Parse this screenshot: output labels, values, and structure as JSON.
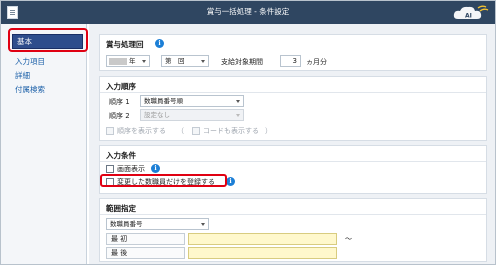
{
  "window": {
    "title": "賞与一括処理 - 条件設定",
    "ai_badge": "AI"
  },
  "sidebar": {
    "items": [
      {
        "label": "基本",
        "active": true
      },
      {
        "label": "入力項目",
        "active": false
      },
      {
        "label": "詳細",
        "active": false
      },
      {
        "label": "付属検索",
        "active": false
      }
    ]
  },
  "sections": {
    "payment_count": {
      "title": "賞与処理回",
      "year_suffix": "年",
      "nth_select": "第",
      "kai_select": "回",
      "period_label": "支給対象期間",
      "period_value": "3",
      "period_unit": "ヵ月分"
    },
    "input_order": {
      "title": "入力順序",
      "order1_label": "順序 1",
      "order1_value": "数職員番号順",
      "order2_label": "順序 2",
      "order2_value": "設定なし",
      "show_order_label": "順序を表示する",
      "show_code_label": "コードも表示する",
      "paren_open": "（",
      "paren_close": "）"
    },
    "input_conditions": {
      "title": "入力条件",
      "screen_display_label": "画面表示",
      "register_changed_label": "変更した数職員だけを登録する"
    },
    "range": {
      "title": "範囲指定",
      "field_value": "数職員番号",
      "first_label": "最 初",
      "last_label": "最 後",
      "tilde": "〜"
    }
  },
  "colors": {
    "titlebar": "#2f4661",
    "sidebar_active": "#2e4d8c",
    "link": "#1a5fa8",
    "highlight": "#e00012",
    "info": "#1c7fd6",
    "range_input": "#fff8cc"
  },
  "icons": {
    "info": "info-icon",
    "app": "document-icon",
    "ai": "ai-cloud-icon"
  }
}
